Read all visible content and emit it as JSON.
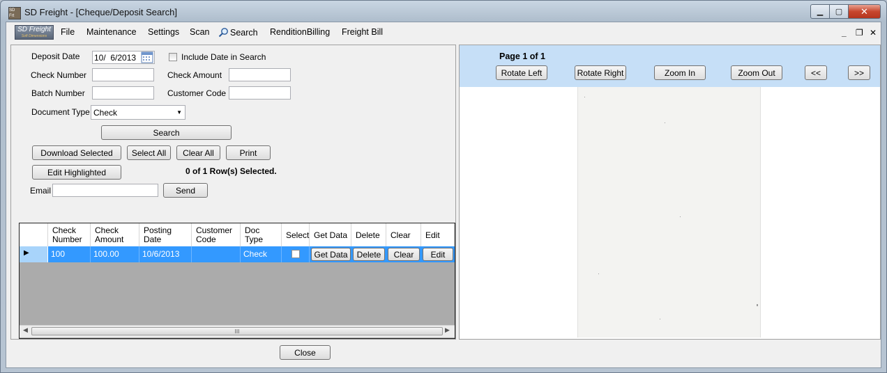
{
  "window": {
    "title": "SD Freight - [Cheque/Deposit  Search]",
    "icon_name": "app-icon"
  },
  "menu": {
    "logo_text": "SD Freight",
    "logo_sub": "Soft Dimensions",
    "items": [
      "File",
      "Maintenance",
      "Settings",
      "Scan",
      "Search",
      "RenditionBilling",
      "Freight Bill"
    ],
    "mdi_controls": [
      "_",
      "❐",
      "✕"
    ]
  },
  "search_form": {
    "deposit_date_label": "Deposit Date",
    "deposit_date_value": "10/  6/2013",
    "include_date_label": "Include Date in Search",
    "check_number_label": "Check Number",
    "check_number_value": "",
    "check_amount_label": "Check Amount",
    "check_amount_value": "",
    "batch_number_label": "Batch Number",
    "batch_number_value": "",
    "customer_code_label": "Customer Code",
    "customer_code_value": "",
    "document_type_label": "Document Type",
    "document_type_value": "Check",
    "search_button": "Search",
    "download_selected": "Download Selected",
    "select_all": "Select All",
    "clear_all": "Clear All",
    "print": "Print",
    "edit_highlighted": "Edit Highlighted",
    "selection_status": "0 of 1 Row(s) Selected.",
    "email_label": "Email",
    "email_value": "",
    "send_button": "Send"
  },
  "grid": {
    "columns": [
      [
        "Check",
        "Number"
      ],
      [
        "Check",
        "Amount"
      ],
      [
        "Posting",
        "Date"
      ],
      [
        "Customer",
        "Code"
      ],
      [
        "Doc",
        "Type"
      ],
      [
        "Select",
        ""
      ],
      [
        "Get Data",
        ""
      ],
      [
        "Delete",
        ""
      ],
      [
        "Clear",
        ""
      ],
      [
        "Edit",
        ""
      ]
    ],
    "rows": [
      {
        "check_number": "100",
        "check_amount": "100.00",
        "posting_date": "10/6/2013",
        "customer_code": "",
        "doc_type": "Check",
        "get_data": "Get Data",
        "delete": "Delete",
        "clear": "Clear",
        "edit": "Edit"
      }
    ],
    "scroll_grip": "III",
    "selected_row_color": "#3399ff"
  },
  "viewer": {
    "page_label": "Page 1 of 1",
    "rotate_left": "Rotate Left",
    "rotate_right": "Rotate Right",
    "zoom_in": "Zoom In",
    "zoom_out": "Zoom Out",
    "prev": "<<",
    "next": ">>"
  },
  "footer": {
    "close_button": "Close"
  }
}
